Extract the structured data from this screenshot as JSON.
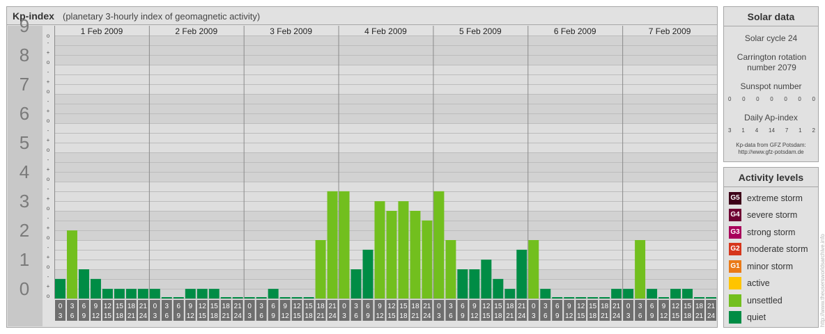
{
  "header": {
    "title": "Kp-index",
    "subtitle": "(planetary 3-hourly index of geomagnetic activity)"
  },
  "chart_data": {
    "type": "bar",
    "title": "Kp-index",
    "subtitle": "(planetary 3-hourly index of geomagnetic activity)",
    "ylim": [
      0,
      9
    ],
    "y_major_labels": [
      "0",
      "1",
      "2",
      "3",
      "4",
      "5",
      "6",
      "7",
      "8",
      "9"
    ],
    "y_minor_labels": [
      "o",
      "+",
      "-"
    ],
    "days": [
      "1 Feb 2009",
      "2 Feb 2009",
      "3 Feb 2009",
      "4 Feb 2009",
      "5 Feb 2009",
      "6 Feb 2009",
      "7 Feb 2009"
    ],
    "interval_labels": [
      [
        "0",
        "3"
      ],
      [
        "3",
        "6"
      ],
      [
        "6",
        "9"
      ],
      [
        "9",
        "12"
      ],
      [
        "12",
        "15"
      ],
      [
        "15",
        "18"
      ],
      [
        "18",
        "21"
      ],
      [
        "21",
        "24"
      ]
    ],
    "values": [
      [
        0.67,
        2.33,
        1.0,
        0.67,
        0.33,
        0.33,
        0.33,
        0.33
      ],
      [
        0.33,
        0.0,
        0.0,
        0.33,
        0.33,
        0.33,
        0.0,
        0.0
      ],
      [
        0.0,
        0.0,
        0.33,
        0.0,
        0.0,
        0.0,
        2.0,
        3.67
      ],
      [
        3.67,
        1.0,
        1.67,
        3.33,
        3.0,
        3.33,
        3.0,
        2.67
      ],
      [
        3.67,
        2.0,
        1.0,
        1.0,
        1.33,
        0.67,
        0.33,
        1.67
      ],
      [
        2.0,
        0.33,
        0.0,
        0.0,
        0.0,
        0.0,
        0.0,
        0.33
      ],
      [
        0.33,
        2.0,
        0.33,
        0.0,
        0.33,
        0.33,
        0.0,
        0.0
      ]
    ],
    "levels": [
      {
        "name": "quiet",
        "range": [
          0,
          2
        ],
        "color": "#008c45"
      },
      {
        "name": "unsettled",
        "range": [
          2,
          4
        ],
        "color": "#72bf1e"
      },
      {
        "name": "active",
        "range": [
          4,
          5
        ],
        "color": "#ffc400"
      }
    ],
    "grid": true
  },
  "solar": {
    "title": "Solar data",
    "cycle": "Solar cycle 24",
    "carrington": "Carrington rotation number 2079",
    "sunspot_label": "Sunspot number",
    "sunspots": [
      "0",
      "0",
      "0",
      "0",
      "0",
      "0",
      "0"
    ],
    "ap_label": "Daily Ap-index",
    "ap": [
      "3",
      "1",
      "4",
      "14",
      "7",
      "1",
      "2"
    ],
    "source_line1": "Kp-data from GFZ Potsdam:",
    "source_line2": "http://www.gfz-potsdam.de"
  },
  "activity": {
    "title": "Activity levels",
    "levels": [
      {
        "code": "G5",
        "label": "extreme storm",
        "color": "#3d0018"
      },
      {
        "code": "G4",
        "label": "severe storm",
        "color": "#6e0033"
      },
      {
        "code": "G3",
        "label": "strong storm",
        "color": "#a8005b"
      },
      {
        "code": "G2",
        "label": "moderate storm",
        "color": "#d6361c"
      },
      {
        "code": "G1",
        "label": "minor storm",
        "color": "#ea7a17"
      },
      {
        "code": "",
        "label": "active",
        "color": "#ffc400"
      },
      {
        "code": "",
        "label": "unsettled",
        "color": "#72bf1e"
      },
      {
        "code": "",
        "label": "quiet",
        "color": "#008c45"
      }
    ]
  },
  "credit": "http://www.theusersworldsarchive.info"
}
